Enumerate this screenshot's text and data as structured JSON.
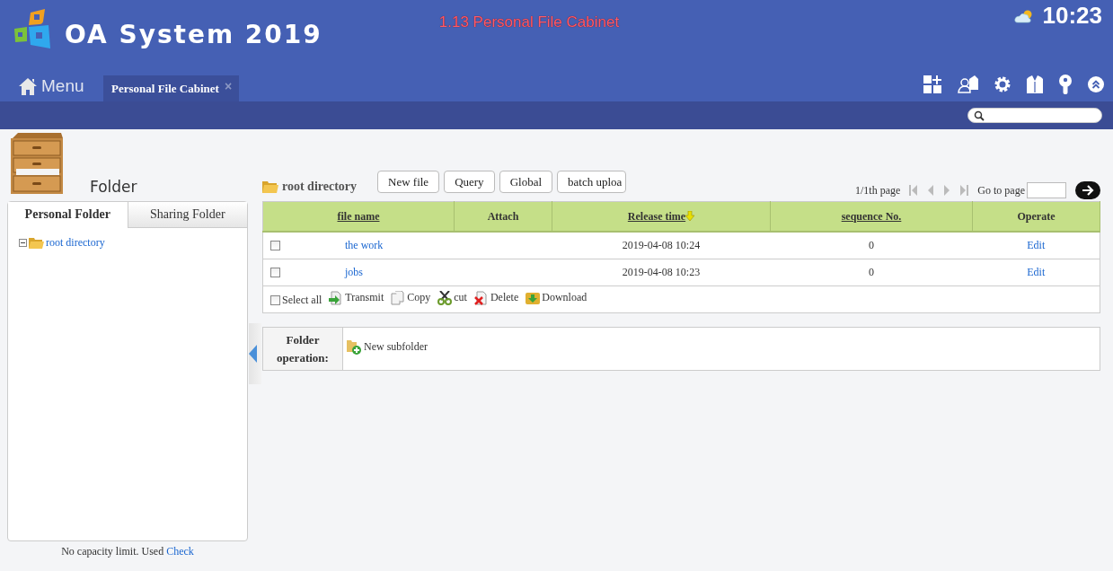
{
  "header": {
    "logo_text": "OA System 2019",
    "caption": "1.13 Personal File Cabinet",
    "time": "10:23"
  },
  "nav": {
    "menu_label": "Menu",
    "tabs": [
      {
        "label": "Personal File Cabinet",
        "selected": true,
        "close": "×"
      }
    ]
  },
  "sidebar": {
    "title": "Folder",
    "tabs": [
      {
        "label": "Personal Folder",
        "selected": true
      },
      {
        "label": "Sharing Folder",
        "selected": false
      }
    ],
    "tree": [
      {
        "label": "root directory",
        "expanded": true
      }
    ],
    "footer": {
      "text": "No capacity limit. Used",
      "link": "Check"
    }
  },
  "main": {
    "path": "root directory",
    "buttons": [
      "New file",
      "Query",
      "Global",
      "batch uploa"
    ],
    "pager": {
      "label": "1/1th page",
      "goto_label": "Go to page"
    },
    "table": {
      "columns": [
        {
          "label": "file name",
          "sortable": true,
          "sorted": false
        },
        {
          "label": "Attach",
          "sortable": false,
          "sorted": false
        },
        {
          "label": "Release time",
          "sortable": true,
          "sorted": true
        },
        {
          "label": "sequence No.",
          "sortable": true,
          "sorted": false
        },
        {
          "label": "Operate",
          "sortable": false,
          "sorted": false
        }
      ],
      "rows": [
        {
          "checked": false,
          "name": "the work",
          "release_time": "2019-04-08 10:24",
          "sequence": "0",
          "operate": "Edit"
        },
        {
          "checked": false,
          "name": "jobs",
          "release_time": "2019-04-08 10:23",
          "sequence": "0",
          "operate": "Edit"
        }
      ],
      "select_all": {
        "label": "Select all",
        "checked": false
      },
      "actions": [
        {
          "kind": "transmit",
          "label": "Transmit"
        },
        {
          "kind": "copy",
          "label": "Copy"
        },
        {
          "kind": "cut",
          "label": "cut"
        },
        {
          "kind": "delete",
          "label": "Delete"
        },
        {
          "kind": "download",
          "label": "Download"
        }
      ]
    },
    "folder_operation": {
      "label": "Folder operation:",
      "actions": [
        {
          "kind": "new-subfolder",
          "label": "New subfolder"
        }
      ]
    }
  }
}
